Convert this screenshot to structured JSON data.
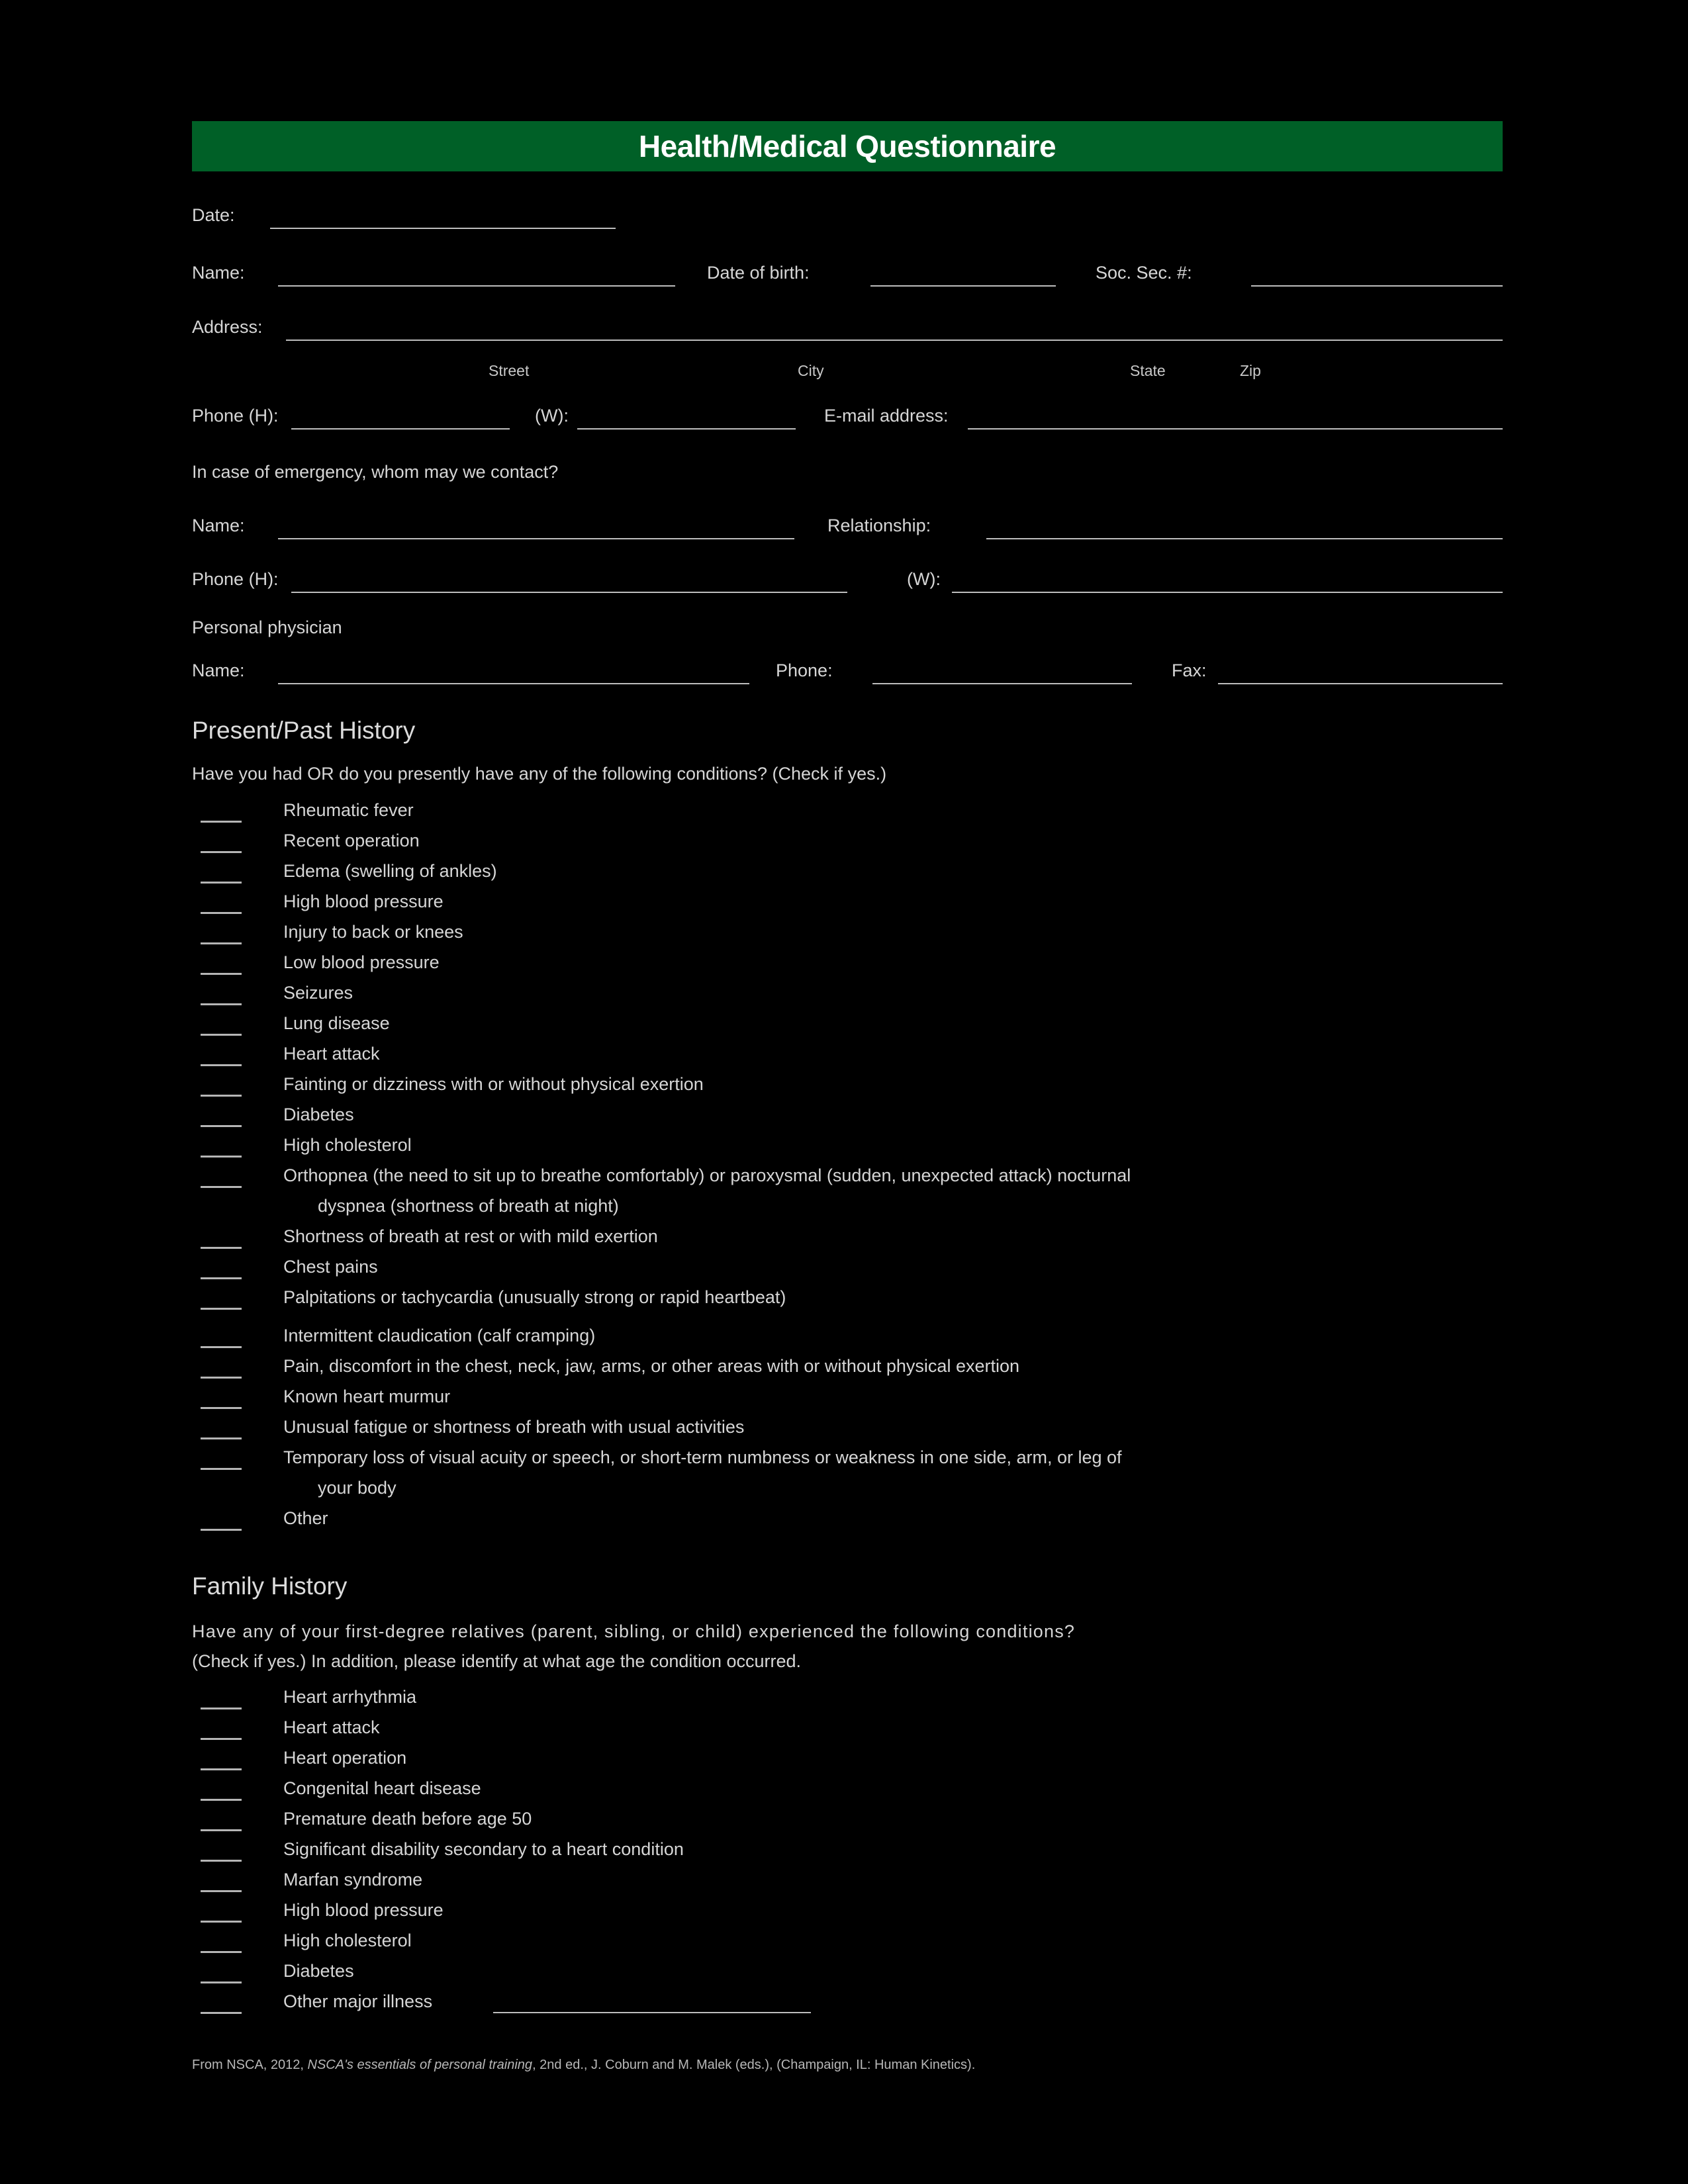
{
  "document": {
    "title": "Health/Medical Questionnaire",
    "banner_color": "#006027",
    "background_color": "#000000",
    "text_color": "#d6d6d6"
  },
  "identification": {
    "date_label": "Date:",
    "name_label": "Name:",
    "dob_label": "Date of birth:",
    "ssn_label": "Soc. Sec. #:",
    "address_label": "Address:",
    "address_sublabels": {
      "street": "Street",
      "city": "City",
      "state": "State",
      "zip": "Zip"
    },
    "phone_home_label": "Phone (H):",
    "phone_work_label": "(W):",
    "email_label": "E-mail address:"
  },
  "emergency": {
    "prompt": "In case of emergency, whom may we contact?",
    "name_label": "Name:",
    "relationship_label": "Relationship:",
    "phone_home_label": "Phone (H):",
    "phone_work_label": "(W):"
  },
  "physician": {
    "heading": "Personal physician",
    "name_label": "Name:",
    "phone_label": "Phone:",
    "fax_label": "Fax:"
  },
  "present_past_history": {
    "heading": "Present/Past History",
    "prompt": "Have you had OR do you presently have any of the following conditions? (Check if yes.)",
    "items": [
      "Rheumatic fever",
      "Recent operation",
      "Edema (swelling of ankles)",
      "High blood pressure",
      "Injury to back or knees",
      "Low blood pressure",
      "Seizures",
      "Lung disease",
      "Heart attack",
      "Fainting or dizziness with or without physical exertion",
      "Diabetes",
      "High cholesterol",
      "Orthopnea (the need to sit up to breathe comfortably) or paroxysmal (sudden, unexpected attack) nocturnal dyspnea (shortness of breath at night)",
      "Shortness of breath at rest or with mild exertion",
      "Chest pains",
      "Palpitations or tachycardia (unusually strong or rapid heartbeat)",
      "Intermittent claudication (calf cramping)",
      "Pain, discomfort in the chest, neck, jaw, arms, or other areas with or without physical exertion",
      "Known heart murmur",
      "Unusual fatigue or shortness of breath with usual activities",
      "Temporary loss of visual acuity or speech, or short-term numbness or weakness in one side, arm, or leg of your body",
      "Other"
    ],
    "wrapped": {
      "orthopnea_line1": "Orthopnea (the need to sit up to breathe comfortably) or paroxysmal (sudden, unexpected attack) nocturnal",
      "orthopnea_line2": "dyspnea (shortness of breath at night)",
      "temporary_line1": "Temporary loss of visual acuity or speech, or short-term numbness or weakness in one side, arm, or leg of",
      "temporary_line2": "your body"
    }
  },
  "family_history": {
    "heading": "Family History",
    "prompt_line1": "Have any of your first-degree relatives (parent, sibling, or child) experienced the following conditions?",
    "prompt_line2": "(Check if yes.) In addition, please identify at what age the condition occurred.",
    "items": [
      "Heart arrhythmia",
      "Heart attack",
      "Heart operation",
      "Congenital heart disease",
      "Premature death before age 50",
      "Significant disability secondary to a heart condition",
      "Marfan syndrome",
      "High blood pressure",
      "High cholesterol",
      "Diabetes",
      "Other major illness"
    ]
  },
  "footer": {
    "credit_prefix": "From NSCA, 2012, ",
    "credit_italic": "NSCA's essentials of personal training",
    "credit_suffix": ", 2nd ed., J. Coburn and M. Malek (eds.), (Champaign, IL: Human Kinetics)."
  }
}
